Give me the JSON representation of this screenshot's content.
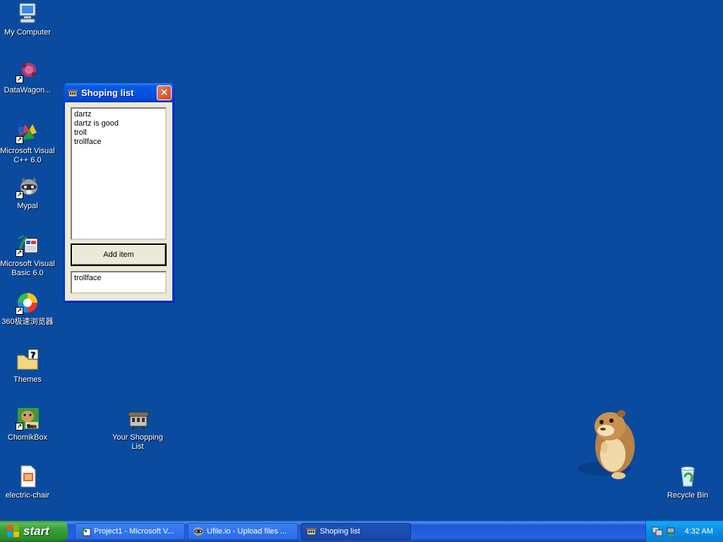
{
  "desktop": {
    "icons": [
      {
        "label": "My Computer",
        "icon": "computer-icon"
      },
      {
        "label": "DataWagon...",
        "icon": "datawagon-icon"
      },
      {
        "label": "Microsoft Visual C++ 6.0",
        "icon": "visual-cpp-icon"
      },
      {
        "label": "Mypal",
        "icon": "raccoon-icon"
      },
      {
        "label": "Microsoft Visual Basic 6.0",
        "icon": "visual-basic-icon"
      },
      {
        "label": "360极速浏览器",
        "icon": "browser-360-icon"
      },
      {
        "label": "Themes",
        "icon": "folder-icon"
      },
      {
        "label": "ChomikBox",
        "icon": "hamster-box-icon"
      },
      {
        "label": "electric-chair",
        "icon": "document-icon"
      },
      {
        "label": "Your Shopping List",
        "icon": "shopping-list-app-icon"
      },
      {
        "label": "Recycle Bin",
        "icon": "recycle-bin-icon"
      }
    ]
  },
  "window": {
    "title": "Shoping list",
    "close_glyph": "✕",
    "list_items": [
      "dartz",
      "dartz is good",
      "troll",
      "trollface"
    ],
    "add_button_label": "Add item",
    "input_value": "trollface"
  },
  "taskbar": {
    "start_label": "start",
    "tasks": [
      {
        "label": "Project1 - Microsoft V...",
        "icon": "vb-project-icon"
      },
      {
        "label": "Ufile.io - Upload files ...",
        "icon": "raccoon-icon"
      },
      {
        "label": "Shoping list",
        "icon": "shopping-list-app-icon"
      }
    ],
    "clock": "4:32 AM"
  },
  "colors": {
    "desktop": "#0a4b9f",
    "title_bar": "#0354e2",
    "start_button": "#37a036",
    "tray": "#0c8ce3"
  }
}
